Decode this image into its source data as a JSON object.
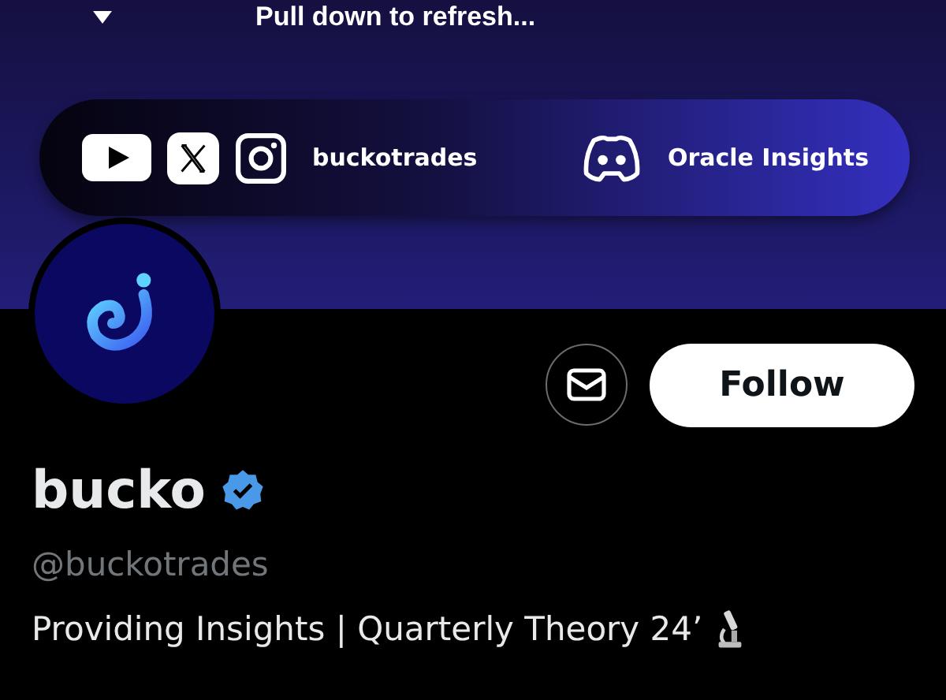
{
  "refresh_hint": "Pull down to refresh...",
  "social_bar": {
    "groups": [
      {
        "icons": [
          {
            "kind": "youtube"
          },
          {
            "kind": "x"
          },
          {
            "kind": "instagram"
          }
        ],
        "label": "buckotrades"
      },
      {
        "icons": [
          {
            "kind": "discord"
          }
        ],
        "label": "Oracle Insights"
      }
    ]
  },
  "profile": {
    "name": "bucko",
    "verified": true,
    "handle": "@buckotrades",
    "bio": "Providing Insights | Quarterly Theory 24’",
    "bio_icon": {
      "kind": "microscope"
    }
  },
  "actions": {
    "follow_label": "Follow"
  }
}
